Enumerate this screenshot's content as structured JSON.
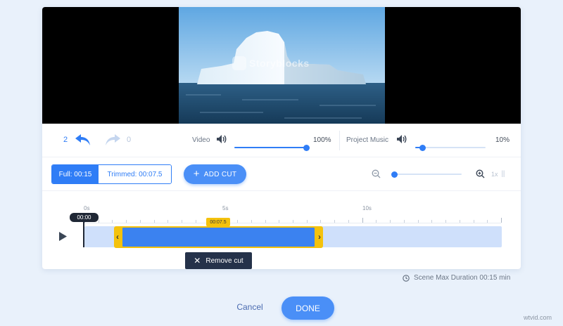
{
  "video": {
    "watermark": "Storyblocks"
  },
  "history": {
    "undo_count": "2",
    "redo_count": "0"
  },
  "audio": {
    "video_label": "Video",
    "video_volume": "100%",
    "video_volume_fraction": 1.0,
    "music_label": "Project Music",
    "music_volume": "10%",
    "music_volume_fraction": 0.1
  },
  "trim": {
    "full_label": "Full: 00:15",
    "trimmed_label": "Trimmed: 00:07.5",
    "add_cut_label": "ADD CUT"
  },
  "zoom": {
    "level": "1x",
    "fraction": 0.0
  },
  "timeline": {
    "tick_labels": [
      "0s",
      "5s",
      "10s"
    ],
    "playhead_time": "00:00",
    "cut_time": "00:07.5",
    "remove_cut_label": "Remove cut"
  },
  "footer": {
    "max_duration": "Scene Max Duration 00:15 min",
    "cancel_label": "Cancel",
    "done_label": "DONE",
    "site_mark": "wtvid.com"
  },
  "colors": {
    "accent": "#2f7df6",
    "cut_handle": "#f4c20d",
    "background": "#e9f1fb"
  }
}
